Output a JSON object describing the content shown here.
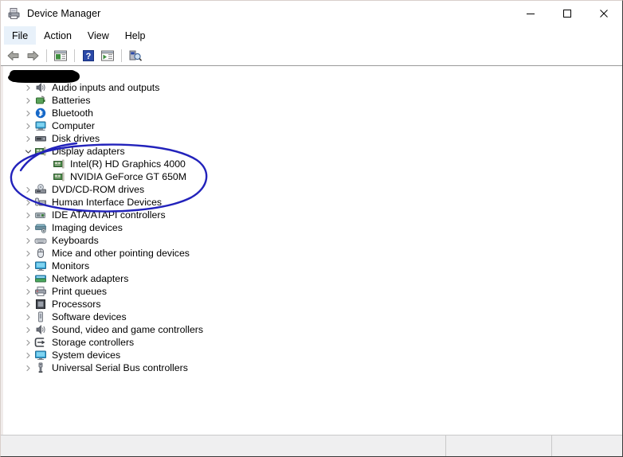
{
  "window": {
    "title": "Device Manager",
    "icon": "device-manager-icon",
    "controls": {
      "minimize": "minimize-icon",
      "maximize": "maximize-icon",
      "close": "close-icon"
    }
  },
  "menubar": {
    "items": [
      {
        "label": "File",
        "active": true
      },
      {
        "label": "Action",
        "active": false
      },
      {
        "label": "View",
        "active": false
      },
      {
        "label": "Help",
        "active": false
      }
    ]
  },
  "toolbar": {
    "buttons": [
      {
        "name": "back-icon",
        "title": "Back"
      },
      {
        "name": "forward-icon",
        "title": "Forward"
      },
      {
        "name": "properties-icon",
        "title": "Properties"
      },
      {
        "name": "help-icon",
        "title": "Help"
      },
      {
        "name": "show-hidden-devices-icon",
        "title": "Show hidden devices"
      },
      {
        "name": "scan-hardware-changes-icon",
        "title": "Scan for hardware changes"
      }
    ]
  },
  "tree": {
    "root": {
      "label": "",
      "redacted": true,
      "expanded": true
    },
    "nodes": [
      {
        "label": "Audio inputs and outputs",
        "icon": "speaker-icon",
        "level": 1,
        "expanded": false
      },
      {
        "label": "Batteries",
        "icon": "battery-icon",
        "level": 1,
        "expanded": false
      },
      {
        "label": "Bluetooth",
        "icon": "bluetooth-icon",
        "level": 1,
        "expanded": false
      },
      {
        "label": "Computer",
        "icon": "computer-icon",
        "level": 1,
        "expanded": false
      },
      {
        "label": "Disk drives",
        "icon": "disk-drive-icon",
        "level": 1,
        "expanded": false
      },
      {
        "label": "Display adapters",
        "icon": "display-adapter-icon",
        "level": 1,
        "expanded": true
      },
      {
        "label": "Intel(R) HD Graphics 4000",
        "icon": "display-adapter-icon",
        "level": 2,
        "expanded": null
      },
      {
        "label": "NVIDIA GeForce GT 650M",
        "icon": "display-adapter-icon",
        "level": 2,
        "expanded": null
      },
      {
        "label": "DVD/CD-ROM drives",
        "icon": "optical-drive-icon",
        "level": 1,
        "expanded": false
      },
      {
        "label": "Human Interface Devices",
        "icon": "hid-icon",
        "level": 1,
        "expanded": false
      },
      {
        "label": "IDE ATA/ATAPI controllers",
        "icon": "ide-controller-icon",
        "level": 1,
        "expanded": false
      },
      {
        "label": "Imaging devices",
        "icon": "imaging-device-icon",
        "level": 1,
        "expanded": false
      },
      {
        "label": "Keyboards",
        "icon": "keyboard-icon",
        "level": 1,
        "expanded": false
      },
      {
        "label": "Mice and other pointing devices",
        "icon": "mouse-icon",
        "level": 1,
        "expanded": false
      },
      {
        "label": "Monitors",
        "icon": "monitor-icon",
        "level": 1,
        "expanded": false
      },
      {
        "label": "Network adapters",
        "icon": "network-adapter-icon",
        "level": 1,
        "expanded": false
      },
      {
        "label": "Print queues",
        "icon": "printer-icon",
        "level": 1,
        "expanded": false
      },
      {
        "label": "Processors",
        "icon": "processor-icon",
        "level": 1,
        "expanded": false
      },
      {
        "label": "Software devices",
        "icon": "software-device-icon",
        "level": 1,
        "expanded": false
      },
      {
        "label": "Sound, video and game controllers",
        "icon": "speaker-icon",
        "level": 1,
        "expanded": false
      },
      {
        "label": "Storage controllers",
        "icon": "storage-controller-icon",
        "level": 1,
        "expanded": false
      },
      {
        "label": "System devices",
        "icon": "system-device-icon",
        "level": 1,
        "expanded": false
      },
      {
        "label": "Universal Serial Bus controllers",
        "icon": "usb-controller-icon",
        "level": 1,
        "expanded": false
      }
    ]
  },
  "annotations": {
    "redaction": {
      "type": "black-marker-bar",
      "color": "#000000",
      "covers": "computer-name-root-node"
    },
    "highlight": {
      "type": "hand-drawn-ellipse",
      "color": "#2222bb",
      "encircles": "Display adapters"
    }
  },
  "statusbar": {
    "main": "",
    "pane2": "",
    "pane3": ""
  }
}
